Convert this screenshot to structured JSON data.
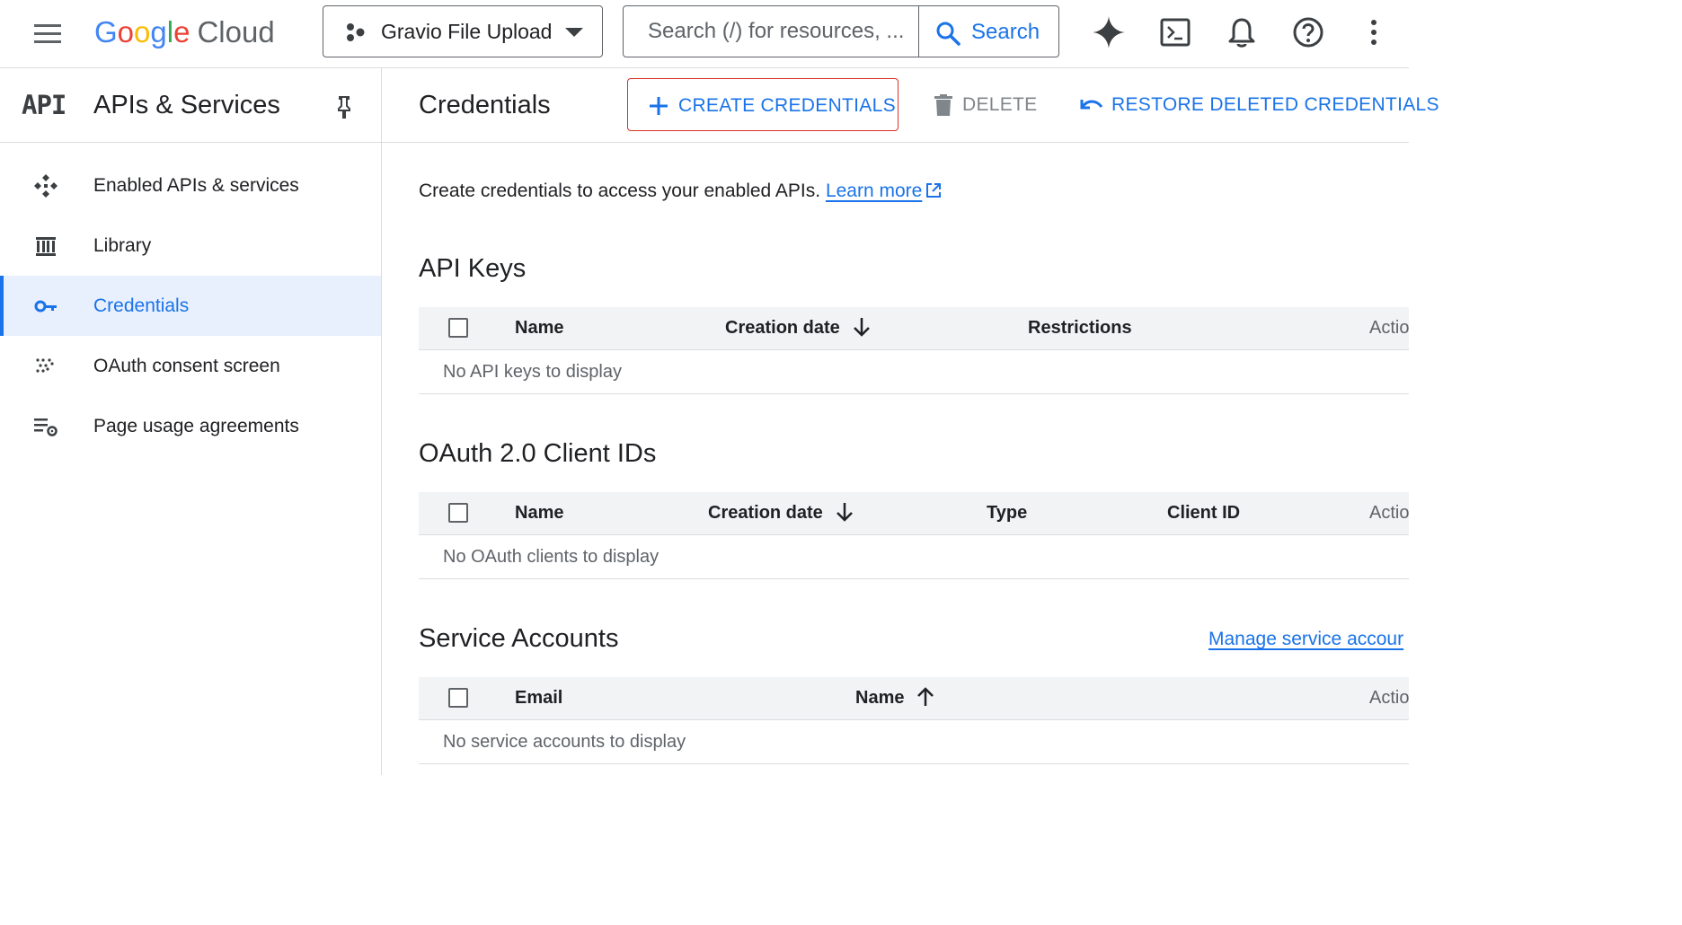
{
  "brand": {
    "google": "Google",
    "cloud": "Cloud"
  },
  "header": {
    "project_name": "Gravio File Upload",
    "search_placeholder": "Search (/) for resources, ...",
    "search_button": "Search",
    "icons": [
      "gemini-icon",
      "cloud-shell-icon",
      "notifications-icon",
      "help-icon",
      "more-vert-icon"
    ]
  },
  "sidebar": {
    "badge": "API",
    "title": "APIs & Services",
    "items": [
      {
        "label": "Enabled APIs & services",
        "icon": "enabled-apis-icon",
        "active": false
      },
      {
        "label": "Library",
        "icon": "library-icon",
        "active": false
      },
      {
        "label": "Credentials",
        "icon": "key-icon",
        "active": true
      },
      {
        "label": "OAuth consent screen",
        "icon": "oauth-icon",
        "active": false
      },
      {
        "label": "Page usage agreements",
        "icon": "settings-list-icon",
        "active": false
      }
    ]
  },
  "main": {
    "title": "Credentials",
    "actions": {
      "create": "CREATE CREDENTIALS",
      "delete": "DELETE",
      "restore": "RESTORE DELETED CREDENTIALS"
    },
    "intro_text": "Create credentials to access your enabled APIs.",
    "learn_more": "Learn more",
    "sections": {
      "api_keys": {
        "title": "API Keys",
        "columns": [
          "Name",
          "Creation date",
          "Restrictions",
          "Actio"
        ],
        "empty": "No API keys to display"
      },
      "oauth": {
        "title": "OAuth 2.0 Client IDs",
        "columns": [
          "Name",
          "Creation date",
          "Type",
          "Client ID",
          "Actio"
        ],
        "empty": "No OAuth clients to display"
      },
      "service_accounts": {
        "title": "Service Accounts",
        "manage_link": "Manage service accour",
        "columns": [
          "Email",
          "Name",
          "Actio"
        ],
        "empty": "No service accounts to display"
      }
    }
  },
  "colors": {
    "accent": "#1a73e8",
    "create_border": "#d93025",
    "active_bg": "#e8f0fe"
  }
}
